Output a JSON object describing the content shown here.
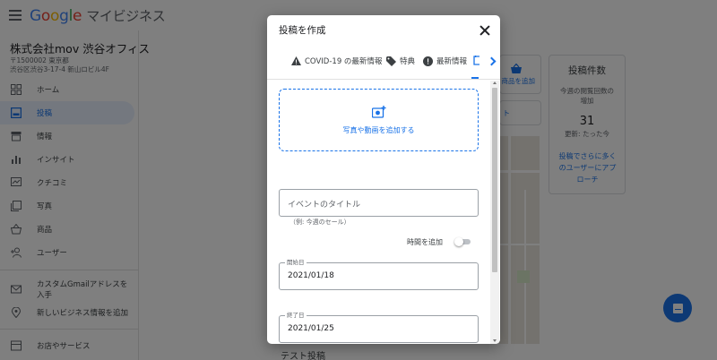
{
  "app": {
    "brand_google": [
      "G",
      "o",
      "o",
      "g",
      "l",
      "e"
    ],
    "product": "マイビジネス"
  },
  "business": {
    "name": "株式会社mov 渋谷オフィス",
    "postal": "〒1500002 東京都",
    "address": "渋谷区渋谷3-17-4 新山ロビル4F"
  },
  "sidebar": {
    "items": [
      {
        "label": "ホーム",
        "icon": "home-dashboard-icon"
      },
      {
        "label": "投稿",
        "icon": "posts-icon",
        "active": true
      },
      {
        "label": "情報",
        "icon": "storefront-icon"
      },
      {
        "label": "インサイト",
        "icon": "bar-chart-icon"
      },
      {
        "label": "クチコミ",
        "icon": "reviews-icon"
      },
      {
        "label": "写真",
        "icon": "photos-icon"
      },
      {
        "label": "商品",
        "icon": "basket-icon"
      },
      {
        "label": "ユーザー",
        "icon": "add-user-icon"
      },
      {
        "label": "カスタムGmailアドレスを入手",
        "icon": "mail-icon"
      },
      {
        "label": "新しいビジネス情報を追加",
        "icon": "location-icon"
      },
      {
        "label": "お店やサービス",
        "icon": "store-icon"
      }
    ]
  },
  "main": {
    "product_button": "商品を追加",
    "tab_partial": "ト",
    "post_count": {
      "title": "投稿件数",
      "subtitle_line1": "今週の閲覧回数の",
      "subtitle_line2": "増加",
      "value": "31",
      "updated": "更新: たった今",
      "link_line1": "投稿でさらに多く",
      "link_line2": "のユーザーにアプ",
      "link_line3": "ローチ"
    },
    "test_post": "テスト投稿"
  },
  "dialog": {
    "title": "投稿を作成",
    "tabs": [
      {
        "label": "COVID-19 の最新情報",
        "icon": "warning-icon"
      },
      {
        "label": "特典",
        "icon": "tag-icon"
      },
      {
        "label": "最新情報",
        "icon": "alert-circle-icon"
      },
      {
        "label": "",
        "icon": "calendar-event-icon",
        "active": true
      }
    ],
    "upload_label": "写真や動画を追加する",
    "event_title_placeholder": "イベントのタイトル",
    "event_title_helper": "（例: 今週のセール）",
    "add_time_label": "時間を追加",
    "add_time_on": false,
    "start_date_label": "開始日",
    "start_date": "2021/01/18",
    "end_date_label": "終了日",
    "end_date": "2021/01/25"
  },
  "colors": {
    "accent": "#1a73e8",
    "active_nav_bg": "#e8f0fe",
    "overlay": "rgba(0,0,0,0.5)"
  }
}
